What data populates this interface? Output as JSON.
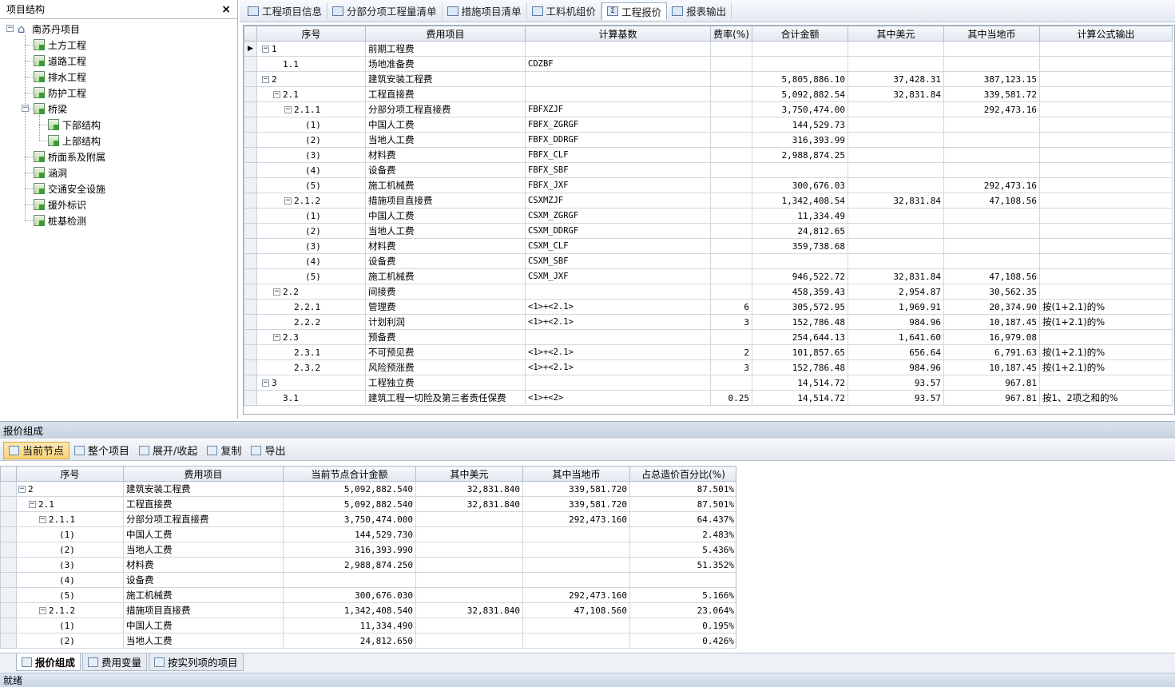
{
  "left_panel": {
    "title": "项目结构",
    "close": "×",
    "root": "南苏丹项目",
    "items": [
      "土方工程",
      "道路工程",
      "排水工程",
      "防护工程",
      "桥梁",
      "下部结构",
      "上部结构",
      "桥面系及附属",
      "涵洞",
      "交通安全设施",
      "援外标识",
      "桩基检测"
    ]
  },
  "tabs": [
    "工程项目信息",
    "分部分项工程量清单",
    "措施项目清单",
    "工料机组价",
    "工程报价",
    "报表输出"
  ],
  "grid1": {
    "headers": [
      "序号",
      "费用项目",
      "计算基数",
      "费率(%)",
      "合计金额",
      "其中美元",
      "其中当地币",
      "计算公式输出"
    ],
    "rows": [
      [
        "1",
        "前期工程费",
        "",
        "",
        "",
        "",
        "",
        ""
      ],
      [
        "1.1",
        "场地准备费",
        "CDZBF",
        "",
        "",
        "",
        "",
        ""
      ],
      [
        "2",
        "建筑安装工程费",
        "",
        "",
        "5,805,886.10",
        "37,428.31",
        "387,123.15",
        ""
      ],
      [
        "2.1",
        "工程直接费",
        "",
        "",
        "5,092,882.54",
        "32,831.84",
        "339,581.72",
        ""
      ],
      [
        "2.1.1",
        "分部分项工程直接费",
        "FBFXZJF",
        "",
        "3,750,474.00",
        "",
        "292,473.16",
        ""
      ],
      [
        "(1)",
        "中国人工费",
        "FBFX_ZGRGF",
        "",
        "144,529.73",
        "",
        "",
        ""
      ],
      [
        "(2)",
        "当地人工费",
        "FBFX_DDRGF",
        "",
        "316,393.99",
        "",
        "",
        ""
      ],
      [
        "(3)",
        "材料费",
        "FBFX_CLF",
        "",
        "2,988,874.25",
        "",
        "",
        ""
      ],
      [
        "(4)",
        "设备费",
        "FBFX_SBF",
        "",
        "",
        "",
        "",
        ""
      ],
      [
        "(5)",
        "施工机械费",
        "FBFX_JXF",
        "",
        "300,676.03",
        "",
        "292,473.16",
        ""
      ],
      [
        "2.1.2",
        "措施项目直接费",
        "CSXMZJF",
        "",
        "1,342,408.54",
        "32,831.84",
        "47,108.56",
        ""
      ],
      [
        "(1)",
        "中国人工费",
        "CSXM_ZGRGF",
        "",
        "11,334.49",
        "",
        "",
        ""
      ],
      [
        "(2)",
        "当地人工费",
        "CSXM_DDRGF",
        "",
        "24,812.65",
        "",
        "",
        ""
      ],
      [
        "(3)",
        "材料费",
        "CSXM_CLF",
        "",
        "359,738.68",
        "",
        "",
        ""
      ],
      [
        "(4)",
        "设备费",
        "CSXM_SBF",
        "",
        "",
        "",
        "",
        ""
      ],
      [
        "(5)",
        "施工机械费",
        "CSXM_JXF",
        "",
        "946,522.72",
        "32,831.84",
        "47,108.56",
        ""
      ],
      [
        "2.2",
        "间接费",
        "",
        "",
        "458,359.43",
        "2,954.87",
        "30,562.35",
        ""
      ],
      [
        "2.2.1",
        "管理费",
        "<1>+<2.1>",
        "6",
        "305,572.95",
        "1,969.91",
        "20,374.90",
        "按(1+2.1)的%"
      ],
      [
        "2.2.2",
        "计划利润",
        "<1>+<2.1>",
        "3",
        "152,786.48",
        "984.96",
        "10,187.45",
        "按(1+2.1)的%"
      ],
      [
        "2.3",
        "预备费",
        "",
        "",
        "254,644.13",
        "1,641.60",
        "16,979.08",
        ""
      ],
      [
        "2.3.1",
        "不可预见费",
        "<1>+<2.1>",
        "2",
        "101,857.65",
        "656.64",
        "6,791.63",
        "按(1+2.1)的%"
      ],
      [
        "2.3.2",
        "风险预涨费",
        "<1>+<2.1>",
        "3",
        "152,786.48",
        "984.96",
        "10,187.45",
        "按(1+2.1)的%"
      ],
      [
        "3",
        "工程独立费",
        "",
        "",
        "14,514.72",
        "93.57",
        "967.81",
        ""
      ],
      [
        "3.1",
        "建筑工程一切险及第三者责任保费",
        "<1>+<2>",
        "0.25",
        "14,514.72",
        "93.57",
        "967.81",
        "按1、2项之和的%"
      ]
    ]
  },
  "bottom": {
    "title": "报价组成",
    "tools": [
      "当前节点",
      "整个项目",
      "展开/收起",
      "复制",
      "导出"
    ],
    "headers": [
      "序号",
      "费用项目",
      "当前节点合计金额",
      "其中美元",
      "其中当地币",
      "占总造价百分比(%)"
    ],
    "rows": [
      [
        "2",
        "建筑安装工程费",
        "5,092,882.540",
        "32,831.840",
        "339,581.720",
        "87.501%"
      ],
      [
        "2.1",
        "工程直接费",
        "5,092,882.540",
        "32,831.840",
        "339,581.720",
        "87.501%"
      ],
      [
        "2.1.1",
        "分部分项工程直接费",
        "3,750,474.000",
        "",
        "292,473.160",
        "64.437%"
      ],
      [
        "(1)",
        "中国人工费",
        "144,529.730",
        "",
        "",
        "2.483%"
      ],
      [
        "(2)",
        "当地人工费",
        "316,393.990",
        "",
        "",
        "5.436%"
      ],
      [
        "(3)",
        "材料费",
        "2,988,874.250",
        "",
        "",
        "51.352%"
      ],
      [
        "(4)",
        "设备费",
        "",
        "",
        "",
        ""
      ],
      [
        "(5)",
        "施工机械费",
        "300,676.030",
        "",
        "292,473.160",
        "5.166%"
      ],
      [
        "2.1.2",
        "措施项目直接费",
        "1,342,408.540",
        "32,831.840",
        "47,108.560",
        "23.064%"
      ],
      [
        "(1)",
        "中国人工费",
        "11,334.490",
        "",
        "",
        "0.195%"
      ],
      [
        "(2)",
        "当地人工费",
        "24,812.650",
        "",
        "",
        "0.426%"
      ]
    ],
    "tabs": [
      "报价组成",
      "费用变量",
      "按实列项的项目"
    ],
    "status": "就绪"
  }
}
